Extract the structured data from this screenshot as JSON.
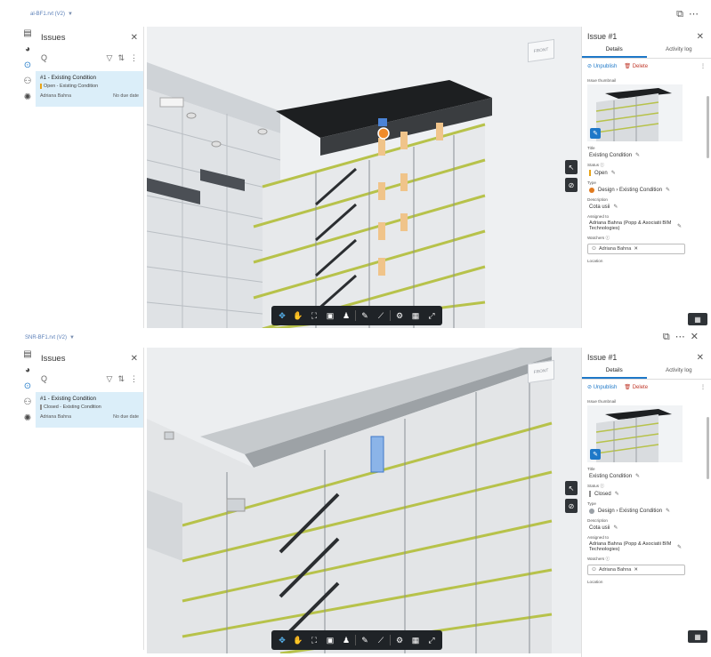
{
  "screens": [
    {
      "file_name": "al-BF1.rvt (V2)",
      "panel_title": "Issues",
      "search_placeholder": "Q",
      "issue_title": "#1 - Existing Condition",
      "issue_status_line": "Open - Existing Condition",
      "issue_assignee": "Adriana Bahna",
      "issue_due": "No due date",
      "detail_title": "Issue #1",
      "tab_details": "Details",
      "tab_activity": "Activity log",
      "unpublish_label": "Unpublish",
      "delete_label": "Delete",
      "thumbnail_label": "Issue thumbnail",
      "title_label": "Title",
      "title_value": "Existing Condition",
      "status_label": "Status",
      "status_value": "Open",
      "status_color": "#e8a317",
      "type_label": "Type",
      "type_value": "Design › Existing Condition",
      "type_color": "#e07a1f",
      "description_label": "Description",
      "description_value": "Cota usii",
      "assigned_label": "Assigned to",
      "assigned_value": "Adriana Bahna (Popp & Asociatii BIM Technologies)",
      "watchers_label": "Watchers",
      "watcher_chip": "Adriana Bahna",
      "location_label": "Location",
      "navcube_label": "FRONT"
    },
    {
      "file_name": "SNR-BF1.rvt (V2)",
      "panel_title": "Issues",
      "search_placeholder": "Q",
      "issue_title": "#1 - Existing Condition",
      "issue_status_line": "Closed - Existing Condition",
      "issue_assignee": "Adriana Bahna",
      "issue_due": "No due date",
      "detail_title": "Issue #1",
      "tab_details": "Details",
      "tab_activity": "Activity log",
      "unpublish_label": "Unpublish",
      "delete_label": "Delete",
      "thumbnail_label": "Issue thumbnail",
      "title_label": "Title",
      "title_value": "Existing Condition",
      "status_label": "Status",
      "status_value": "Closed",
      "status_color": "#8c8c8c",
      "type_label": "Type",
      "type_value": "Design › Existing Condition",
      "type_color": "#9aa0a6",
      "description_label": "Description",
      "description_value": "Cota usii",
      "assigned_label": "Assigned to",
      "assigned_value": "Adriana Bahna (Popp & Asociatii BIM Technologies)",
      "watchers_label": "Watchers",
      "watcher_chip": "Adriana Bahna",
      "location_label": "Location",
      "navcube_label": "FRONT"
    }
  ],
  "icons": {
    "panel_rail": [
      "layers-icon",
      "globe-icon",
      "issues-icon",
      "people-icon",
      "settings-icon"
    ],
    "toolbar": [
      "orbit-icon",
      "pan-icon",
      "fit-view-icon",
      "section-box-icon",
      "walk-icon",
      "markup-icon",
      "measure-icon",
      "settings-icon",
      "explode-icon",
      "fullscreen-icon"
    ]
  },
  "colors": {
    "accent": "#1e78c8",
    "selected_row": "#dbeef9",
    "toolbar_bg": "#1f2327"
  }
}
